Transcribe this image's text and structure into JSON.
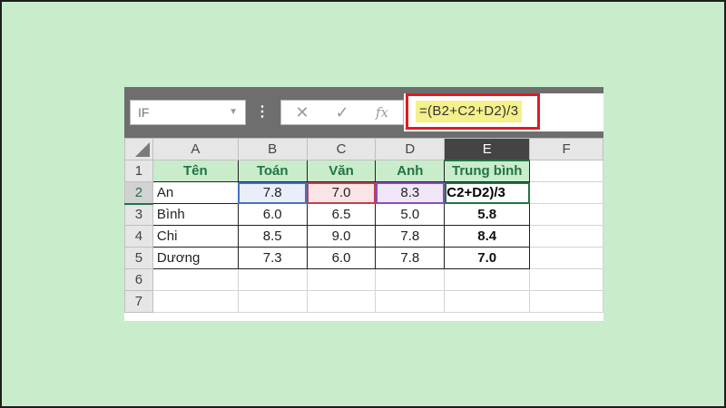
{
  "formula_bar": {
    "name_box": "IF",
    "more_icon": "⋮",
    "cancel_icon": "✕",
    "enter_icon": "✓",
    "fx_icon": "fx",
    "formula": "=(B2+C2+D2)/3"
  },
  "columns": [
    "A",
    "B",
    "C",
    "D",
    "E",
    "F"
  ],
  "rows": [
    "1",
    "2",
    "3",
    "4",
    "5",
    "6",
    "7"
  ],
  "table": {
    "headers": [
      "Tên",
      "Toán",
      "Văn",
      "Anh",
      "Trung bình"
    ],
    "data": [
      {
        "name": "An",
        "toan": "7.8",
        "van": "7.0",
        "anh": "8.3",
        "avg": "C2+D2)/3"
      },
      {
        "name": "Bình",
        "toan": "6.0",
        "van": "6.5",
        "anh": "5.0",
        "avg": "5.8"
      },
      {
        "name": "Chi",
        "toan": "8.5",
        "van": "9.0",
        "anh": "7.8",
        "avg": "8.4"
      },
      {
        "name": "Dương",
        "toan": "7.3",
        "van": "6.0",
        "anh": "7.8",
        "avg": "7.0"
      }
    ]
  },
  "colors": {
    "background": "#c9eccb",
    "highlight_border": "#e21b23",
    "header_text": "#217346",
    "ref_b": "#4472c4",
    "ref_c": "#c0404f",
    "ref_d": "#8a4cbf"
  }
}
